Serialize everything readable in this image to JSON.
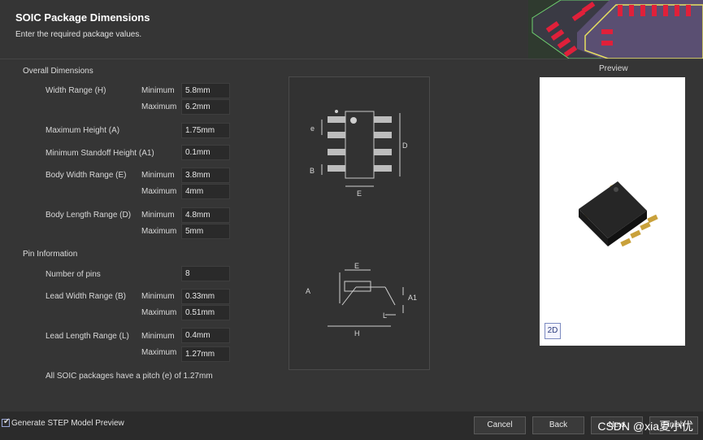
{
  "header": {
    "title": "SOIC Package Dimensions",
    "subtitle": "Enter the required package values."
  },
  "overall": {
    "section_label": "Overall Dimensions",
    "width_range_label": "Width Range (H)",
    "width_min": "5.8mm",
    "width_max": "6.2mm",
    "max_height_label": "Maximum Height (A)",
    "max_height": "1.75mm",
    "standoff_label": "Minimum Standoff Height (A1)",
    "standoff": "0.1mm",
    "body_width_label": "Body Width Range (E)",
    "body_width_min": "3.8mm",
    "body_width_max": "4mm",
    "body_length_label": "Body Length Range (D)",
    "body_length_min": "4.8mm",
    "body_length_max": "5mm"
  },
  "pins": {
    "section_label": "Pin Information",
    "num_pins_label": "Number of pins",
    "num_pins": "8",
    "lead_width_label": "Lead Width Range (B)",
    "lead_width_min": "0.33mm",
    "lead_width_max": "0.51mm",
    "lead_length_label": "Lead Length Range (L)",
    "lead_length_min": "0.4mm",
    "lead_length_max": "1.27mm",
    "pitch_note": "All SOIC packages have a pitch (e) of 1.27mm"
  },
  "common": {
    "minimum": "Minimum",
    "maximum": "Maximum"
  },
  "diagram": {
    "e": "e",
    "b": "B",
    "d": "D",
    "e_body": "E",
    "a": "A",
    "a1": "A1",
    "l": "L",
    "h": "H"
  },
  "preview": {
    "title": "Preview",
    "toggle_2d": "2D"
  },
  "footer": {
    "generate_step_label": "Generate STEP Model Preview",
    "generate_step_checked": true,
    "cancel": "Cancel",
    "back": "Back",
    "next": "Next",
    "finish": "Finish",
    "watermark": "CSDN @xia夏小优"
  }
}
